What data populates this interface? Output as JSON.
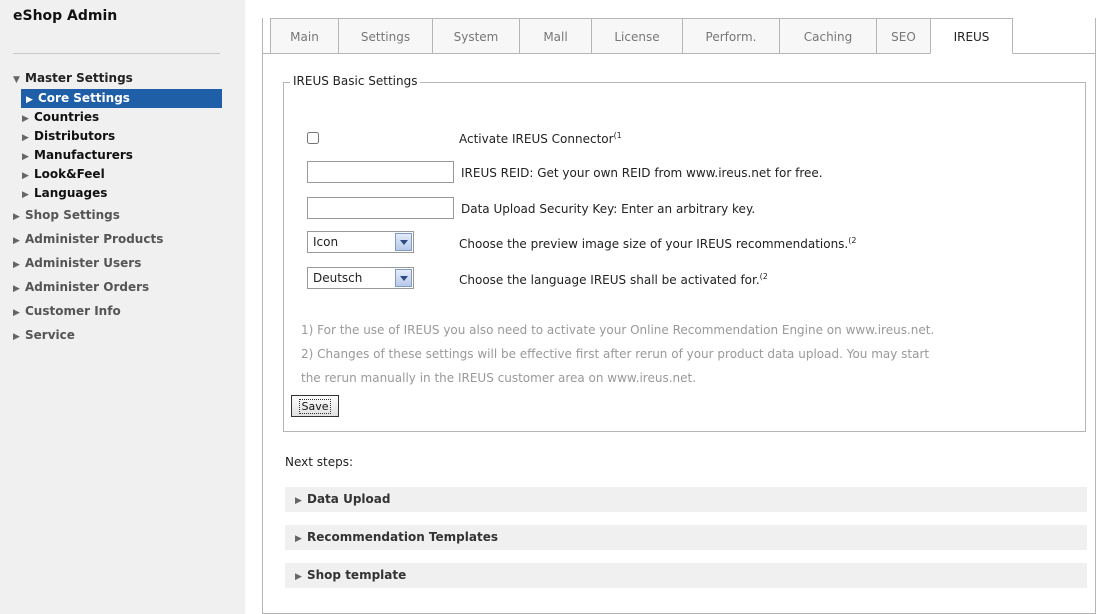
{
  "app": {
    "title": "eShop Admin"
  },
  "sidebar": {
    "items": [
      {
        "label": "Master Settings",
        "level": 0,
        "expanded": true
      },
      {
        "label": "Core Settings",
        "level": 1,
        "active": true
      },
      {
        "label": "Countries",
        "level": 1
      },
      {
        "label": "Distributors",
        "level": 1
      },
      {
        "label": "Manufacturers",
        "level": 1
      },
      {
        "label": "Look&Feel",
        "level": 1
      },
      {
        "label": "Languages",
        "level": 1
      },
      {
        "label": "Shop Settings",
        "level": 0
      },
      {
        "label": "Administer Products",
        "level": 0
      },
      {
        "label": "Administer Users",
        "level": 0
      },
      {
        "label": "Administer Orders",
        "level": 0
      },
      {
        "label": "Customer Info",
        "level": 0
      },
      {
        "label": "Service",
        "level": 0
      }
    ]
  },
  "tabs": [
    {
      "label": "Main"
    },
    {
      "label": "Settings"
    },
    {
      "label": "System"
    },
    {
      "label": "Mall"
    },
    {
      "label": "License"
    },
    {
      "label": "Perform."
    },
    {
      "label": "Caching"
    },
    {
      "label": "SEO"
    },
    {
      "label": "IREUS",
      "active": true
    }
  ],
  "form": {
    "legend": "IREUS Basic Settings",
    "activate": {
      "label": "Activate IREUS Connector",
      "sup": "(1",
      "checked": false
    },
    "reid": {
      "label": "IREUS REID: Get your own REID from www.ireus.net for free.",
      "value": ""
    },
    "security_key": {
      "label": "Data Upload Security Key: Enter an arbitrary key.",
      "value": ""
    },
    "image_size": {
      "selected": "Icon",
      "label": "Choose the preview image size of your IREUS recommendations.",
      "sup": "(2"
    },
    "language": {
      "selected": "Deutsch",
      "label": "Choose the language IREUS shall be activated for.",
      "sup": "(2"
    },
    "notes": [
      "1) For the use of IREUS you also need to activate your Online Recommendation Engine on www.ireus.net.",
      "2) Changes of these settings will be effective first after rerun of your product data upload. You may start",
      "the rerun manually in the IREUS customer area on www.ireus.net."
    ],
    "save_label": "Save"
  },
  "next_steps": {
    "label": "Next steps:",
    "items": [
      {
        "label": "Data Upload"
      },
      {
        "label": "Recommendation Templates"
      },
      {
        "label": "Shop template"
      }
    ]
  }
}
